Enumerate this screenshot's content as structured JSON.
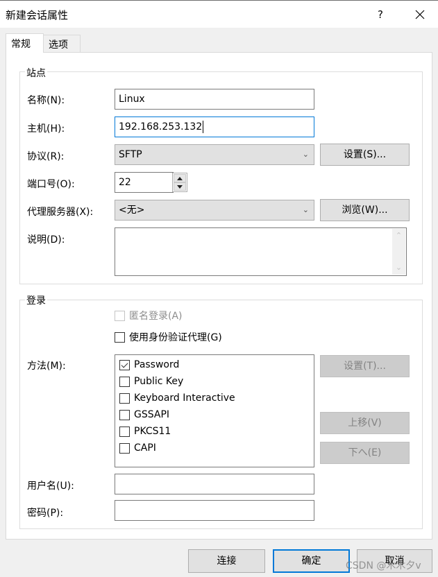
{
  "window": {
    "title": "新建会话属性",
    "help_label": "?",
    "close_icon": "close-icon"
  },
  "tabs": [
    {
      "label": "常规",
      "active": true
    },
    {
      "label": "选项",
      "active": false
    }
  ],
  "site_group": {
    "legend": "站点",
    "name_label": "名称(N):",
    "name_value": "Linux",
    "host_label": "主机(H):",
    "host_value": "192.168.253.132",
    "protocol_label": "协议(R):",
    "protocol_value": "SFTP",
    "protocol_settings_button": "设置(S)...",
    "port_label": "端口号(O):",
    "port_value": "22",
    "proxy_label": "代理服务器(X):",
    "proxy_value": "<无>",
    "proxy_browse_button": "浏览(W)...",
    "description_label": "说明(D):",
    "description_value": ""
  },
  "login_group": {
    "legend": "登录",
    "anonymous_label": "匿名登录(A)",
    "anonymous_checked": false,
    "anonymous_disabled": true,
    "agent_label": "使用身份验证代理(G)",
    "agent_checked": false,
    "method_label": "方法(M):",
    "methods": [
      {
        "label": "Password",
        "checked": true
      },
      {
        "label": "Public Key",
        "checked": false
      },
      {
        "label": "Keyboard Interactive",
        "checked": false
      },
      {
        "label": "GSSAPI",
        "checked": false
      },
      {
        "label": "PKCS11",
        "checked": false
      },
      {
        "label": "CAPI",
        "checked": false
      }
    ],
    "method_settings_button": "设置(T)...",
    "move_up_button": "上移(V)",
    "move_down_button": "下へ(E)",
    "username_label": "用户名(U):",
    "username_value": "",
    "password_label": "密码(P):",
    "password_value": ""
  },
  "footer": {
    "connect_button": "连接",
    "ok_button": "确定",
    "cancel_button": "取消"
  },
  "watermark": "CSDN @木木夕v",
  "colors": {
    "focus_accent": "#0078d7",
    "dialog_bg": "#f0f0f0",
    "button_bg": "#e1e1e1",
    "disabled_button_bg": "#cccccc"
  }
}
